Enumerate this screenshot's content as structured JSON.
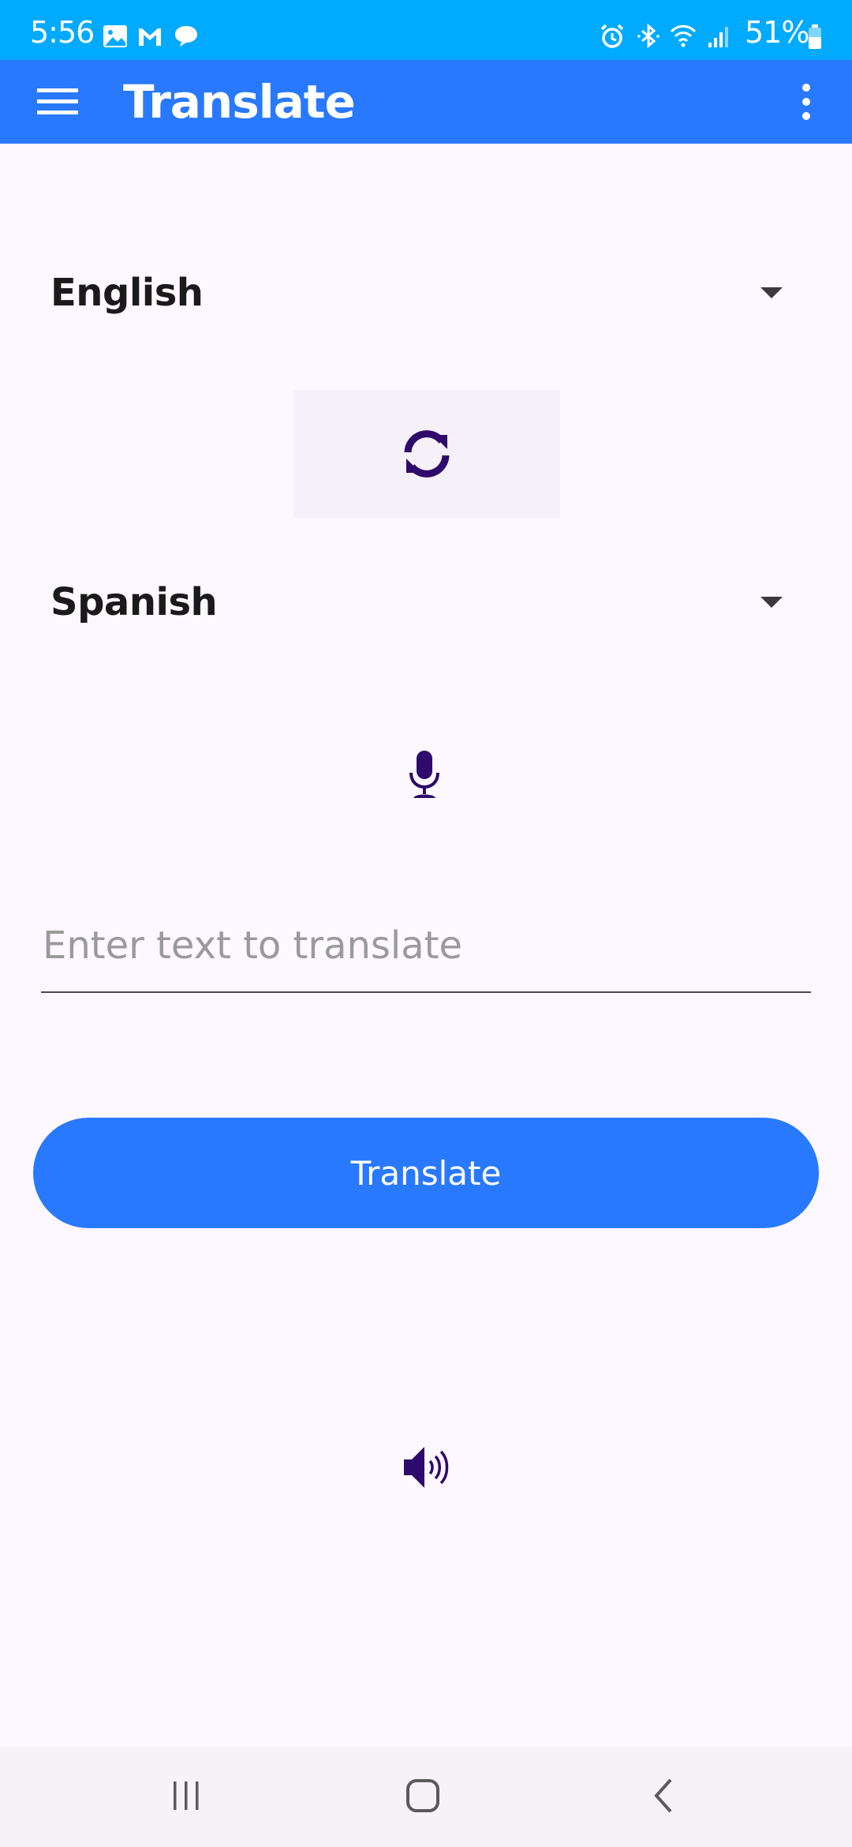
{
  "status_bar": {
    "time": "5:56",
    "battery_percent": "51%",
    "icons": [
      "gallery-icon",
      "gmail-icon",
      "chat-icon",
      "alarm-icon",
      "bluetooth-icon",
      "wifi-icon",
      "signal-icon",
      "battery-icon"
    ]
  },
  "app_bar": {
    "title": "Translate",
    "menu_icon": "menu-icon",
    "more_icon": "more-vert-icon"
  },
  "source_language": {
    "selected": "English"
  },
  "target_language": {
    "selected": "Spanish"
  },
  "swap_icon": "swap-icon",
  "mic_icon": "microphone-icon",
  "input": {
    "placeholder": "Enter text to translate",
    "value": ""
  },
  "translate_button": {
    "label": "Translate"
  },
  "speaker_icon": "speaker-icon",
  "nav_bar": {
    "icons": [
      "recent-apps-icon",
      "home-icon",
      "back-icon"
    ]
  },
  "colors": {
    "status_bar": "#00aaff",
    "app_bar": "#2979ff",
    "accent": "#2979ff",
    "icon": "#2d0a6b",
    "background": "#fdf7ff"
  }
}
